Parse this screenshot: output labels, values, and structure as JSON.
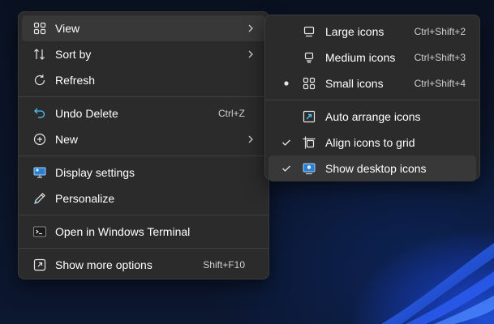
{
  "main_menu": {
    "items": [
      {
        "label": "View",
        "icon": "view-grid-icon",
        "has_submenu": true,
        "highlighted": true
      },
      {
        "label": "Sort by",
        "icon": "sort-icon",
        "has_submenu": true
      },
      {
        "label": "Refresh",
        "icon": "refresh-icon"
      },
      {
        "label": "Undo Delete",
        "icon": "undo-icon",
        "shortcut": "Ctrl+Z"
      },
      {
        "label": "New",
        "icon": "new-plus-icon",
        "has_submenu": true
      },
      {
        "label": "Display settings",
        "icon": "display-settings-icon"
      },
      {
        "label": "Personalize",
        "icon": "personalize-pen-icon"
      },
      {
        "label": "Open in Windows Terminal",
        "icon": "terminal-icon"
      },
      {
        "label": "Show more options",
        "icon": "show-more-options-icon",
        "shortcut": "Shift+F10"
      }
    ]
  },
  "view_submenu": {
    "items": [
      {
        "label": "Large icons",
        "icon": "large-icons-icon",
        "shortcut": "Ctrl+Shift+2"
      },
      {
        "label": "Medium icons",
        "icon": "medium-icons-icon",
        "shortcut": "Ctrl+Shift+3"
      },
      {
        "label": "Small icons",
        "icon": "small-icons-icon",
        "shortcut": "Ctrl+Shift+4",
        "selected_bullet": true
      },
      {
        "label": "Auto arrange icons",
        "icon": "auto-arrange-icon"
      },
      {
        "label": "Align icons to grid",
        "icon": "align-grid-icon",
        "checked": true
      },
      {
        "label": "Show desktop icons",
        "icon": "show-desktop-icons-icon",
        "checked": true,
        "highlighted": true
      }
    ]
  },
  "colors": {
    "menu_bg": "#2b2b2b",
    "highlight": "#383838",
    "accent": "#4cc2ff",
    "text": "#ffffff"
  }
}
